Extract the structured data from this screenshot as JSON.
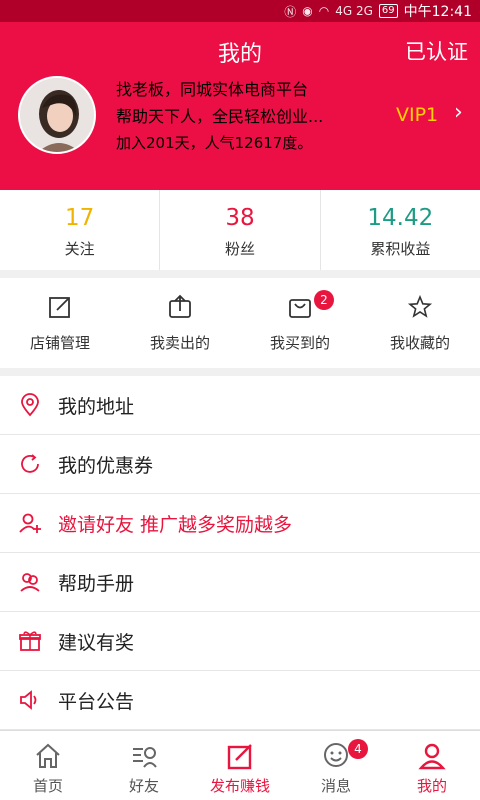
{
  "status_bar": {
    "battery": "69",
    "time": "中午12:41",
    "network": "4G 2G"
  },
  "header": {
    "title": "我的",
    "verify_label": "已认证"
  },
  "profile": {
    "line1": "找老板，同城实体电商平台",
    "line2": "帮助天下人，全民轻松创业...",
    "line3": "加入201天，人气12617度。",
    "vip_label": "VIP1"
  },
  "stats": [
    {
      "value": "17",
      "label": "关注",
      "color": "#f0b400"
    },
    {
      "value": "38",
      "label": "粉丝",
      "color": "#e8163f"
    },
    {
      "value": "14.42",
      "label": "累积收益",
      "color": "#1e9b85"
    }
  ],
  "shortcuts": [
    {
      "label": "店铺管理",
      "icon": "edit-square-icon"
    },
    {
      "label": "我卖出的",
      "icon": "share-upload-icon"
    },
    {
      "label": "我买到的",
      "icon": "shopping-bag-icon",
      "badge": "2"
    },
    {
      "label": "我收藏的",
      "icon": "star-icon"
    }
  ],
  "menu": [
    {
      "label": "我的地址",
      "icon": "location-pin-icon"
    },
    {
      "label": "我的优惠券",
      "icon": "coupon-refresh-icon"
    },
    {
      "label": "邀请好友 推广越多奖励越多",
      "icon": "add-user-icon"
    },
    {
      "label": "帮助手册",
      "icon": "help-users-icon"
    },
    {
      "label": "建议有奖",
      "icon": "gift-icon"
    },
    {
      "label": "平台公告",
      "icon": "speaker-icon"
    }
  ],
  "tabs": [
    {
      "label": "首页",
      "icon": "home-icon"
    },
    {
      "label": "好友",
      "icon": "friends-list-icon"
    },
    {
      "label": "发布赚钱",
      "icon": "publish-edit-icon"
    },
    {
      "label": "消息",
      "icon": "chat-icon",
      "badge": "4"
    },
    {
      "label": "我的",
      "icon": "user-icon"
    }
  ],
  "colors": {
    "brand_red": "#ec0f45",
    "accent_red": "#e8163f",
    "vip_yellow": "#ffd200"
  }
}
